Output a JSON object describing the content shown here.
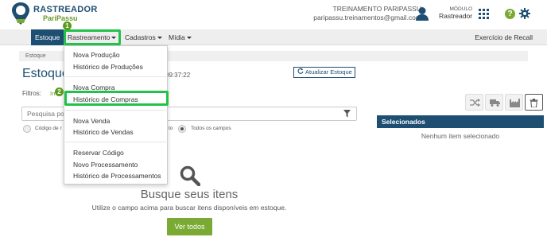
{
  "header": {
    "brand_name": "RASTREADOR",
    "brand_sub": "PariPassu",
    "user_name": "TREINAMENTO PARIPASSU",
    "user_email": "paripassu.treinamentos@gmail.com",
    "module_label": "MÓDULO",
    "module_value": "Rastreador",
    "help_glyph": "?"
  },
  "navbar": {
    "items": [
      {
        "label": "Estoque",
        "icon": null
      },
      {
        "label": "Rastreamento",
        "icon": "caret-down-icon"
      },
      {
        "label": "Cadastros",
        "icon": "caret-down-icon"
      },
      {
        "label": "Mídia",
        "icon": "caret-down-icon"
      }
    ],
    "right_link": "Exercício de Recall"
  },
  "breadcrumb": "Estoque",
  "page": {
    "title": "Estoque",
    "time": "09:37:22",
    "refresh_label": "Atualizar Estoque",
    "filters_label": "Filtros:",
    "filters_tab": "In",
    "search_placeholder": "Pesquisa po",
    "radios": [
      {
        "label": "Código de r",
        "checked": false
      },
      {
        "label": "to",
        "checked": false
      },
      {
        "label": "Todos os campos",
        "checked": true
      }
    ]
  },
  "actions": {
    "icons": [
      "shuffle-icon",
      "truck-icon",
      "factory-icon",
      "trash-icon"
    ]
  },
  "selected": {
    "title": "Selecionados",
    "empty_text": "Nenhum item selecionado"
  },
  "empty_state": {
    "title": "Busque seus itens",
    "description": "Utilize o campo acima para buscar itens disponíveis em estoque.",
    "button_label": "Ver todos"
  },
  "dropdown": {
    "items": [
      "Nova Produção",
      "Histórico de Produções",
      "Nova Compra",
      "Histórico de Compras",
      "Nova Venda",
      "Histórico de Vendas",
      "Reservar Código",
      "Novo Processamento",
      "Histórico de Processamentos"
    ]
  },
  "annotations": {
    "badge_1": "1",
    "badge_2": "2",
    "highlight_color": "#22c24a"
  },
  "colors": {
    "primary": "#1e4f73",
    "accent_green": "#7aaa33"
  }
}
